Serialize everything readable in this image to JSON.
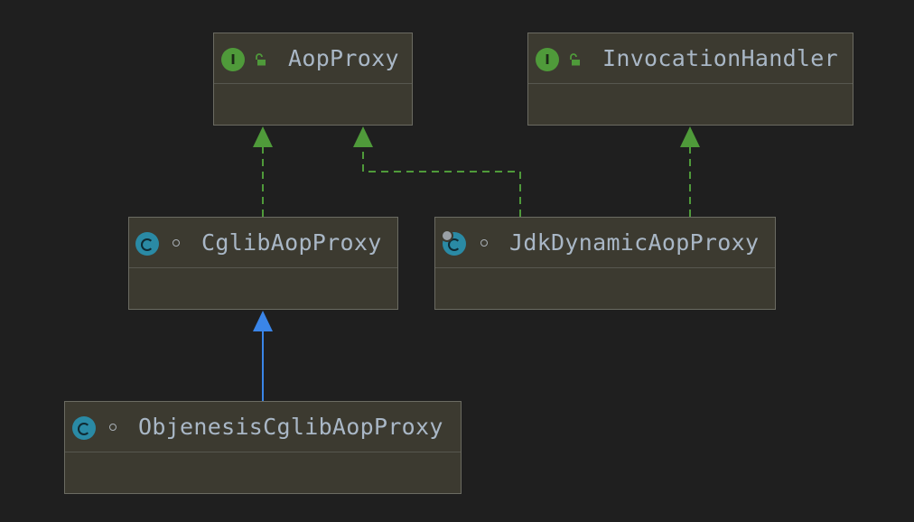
{
  "diagram": {
    "colors": {
      "background": "#1f1f1f",
      "node_fill": "#3c3a30",
      "node_border": "#6b6b62",
      "title_text": "#a9b7c6",
      "interface_badge": "#4f9a3a",
      "class_badge": "#2a8aa5",
      "realization_edge": "#4f9a3a",
      "inheritance_edge": "#3a85e8"
    },
    "nodes": {
      "aop_proxy": {
        "title": "AopProxy",
        "kind": "interface",
        "kind_letter": "I",
        "visibility": "open-lock-icon"
      },
      "invocation_handler": {
        "title": "InvocationHandler",
        "kind": "interface",
        "kind_letter": "I",
        "visibility": "open-lock-icon"
      },
      "cglib_aop_proxy": {
        "title": "CglibAopProxy",
        "kind": "class",
        "kind_letter": "",
        "visibility": "package-private-dot-icon"
      },
      "jdk_dynamic_aop_proxy": {
        "title": "JdkDynamicAopProxy",
        "kind": "class",
        "kind_letter": "",
        "visibility": "package-private-dot-icon"
      },
      "objenesis_cglib_aop_proxy": {
        "title": "ObjenesisCglibAopProxy",
        "kind": "class",
        "kind_letter": "",
        "visibility": "package-private-dot-icon"
      }
    },
    "edges": [
      {
        "from": "CglibAopProxy",
        "to": "AopProxy",
        "type": "realization"
      },
      {
        "from": "JdkDynamicAopProxy",
        "to": "AopProxy",
        "type": "realization"
      },
      {
        "from": "JdkDynamicAopProxy",
        "to": "InvocationHandler",
        "type": "realization"
      },
      {
        "from": "ObjenesisCglibAopProxy",
        "to": "CglibAopProxy",
        "type": "inheritance"
      }
    ]
  }
}
